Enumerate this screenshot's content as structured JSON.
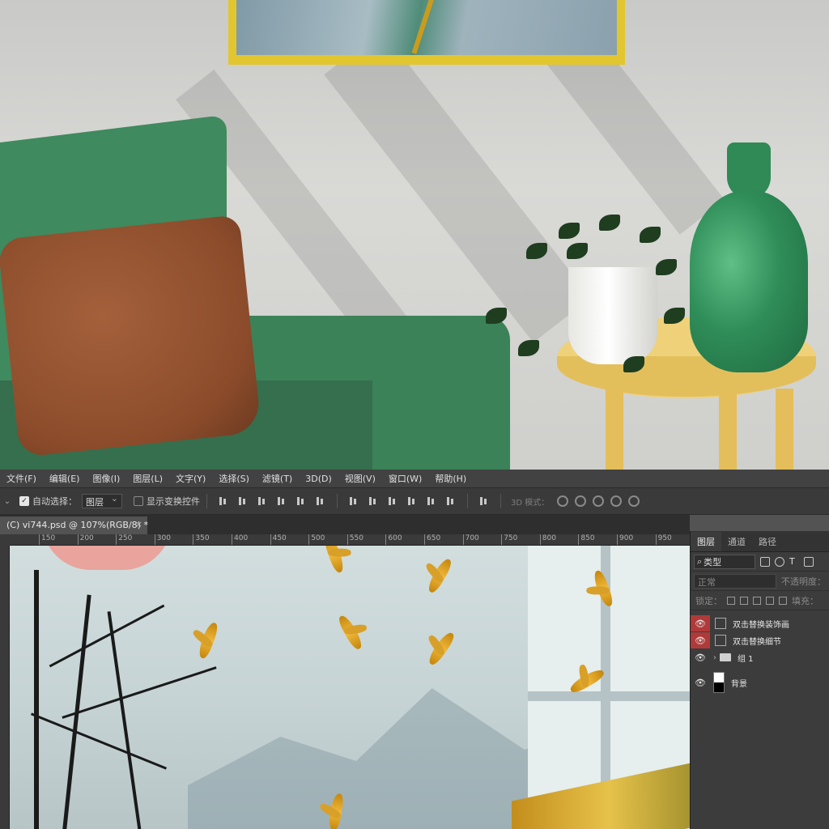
{
  "menu": [
    "文件(F)",
    "编辑(E)",
    "图像(I)",
    "图层(L)",
    "文字(Y)",
    "选择(S)",
    "滤镜(T)",
    "3D(D)",
    "视图(V)",
    "窗口(W)",
    "帮助(H)"
  ],
  "options": {
    "auto_select_label": "自动选择：",
    "auto_select_target": "图层",
    "show_transform_label": "显示变换控件",
    "mode3d_label": "3D 模式："
  },
  "document_tab": {
    "title": "(C) vi744.psd @ 107%(RGB/8) *",
    "close": "×"
  },
  "ruler_ticks": [
    "150",
    "200",
    "250",
    "300",
    "350",
    "400",
    "450",
    "500",
    "550",
    "600",
    "650",
    "700",
    "750",
    "800",
    "850",
    "900",
    "950"
  ],
  "panel": {
    "tabs": [
      "图层",
      "通道",
      "路径"
    ],
    "filter_label": "类型",
    "blend_mode": "正常",
    "opacity_label": "不透明度：",
    "lock_label": "锁定：",
    "fill_label": "填充："
  },
  "layers": [
    {
      "name": "双击替换装饰画",
      "visible_highlight": true
    },
    {
      "name": "双击替换细节",
      "visible_highlight": true
    },
    {
      "name": "组 1",
      "visible_highlight": false
    },
    {
      "name": "背景",
      "visible_highlight": false
    }
  ],
  "colors": {
    "menubar_bg": "#424242",
    "panel_bg": "#3c3c3c",
    "eye_highlight": "#b03a3a",
    "frame_gold": "#e2c630"
  }
}
